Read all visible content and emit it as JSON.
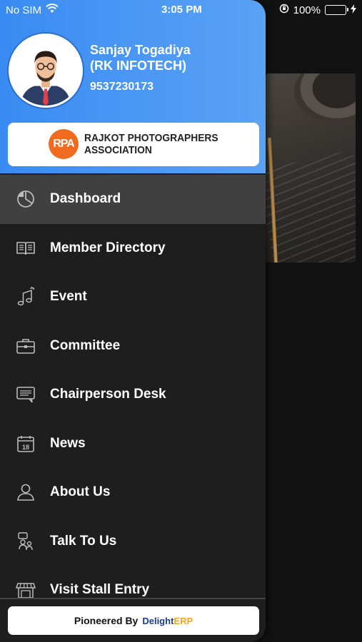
{
  "status_bar": {
    "carrier": "No SIM",
    "time": "3:05 PM",
    "battery": "100%"
  },
  "profile": {
    "name": "Sanjay Togadiya",
    "company": "(RK INFOTECH)",
    "phone": "9537230173"
  },
  "association": {
    "logo_text": "RPA",
    "line1": "RAJKOT PHOTOGRAPHERS",
    "line2": "ASSOCIATION"
  },
  "menu": {
    "items": [
      {
        "label": "Dashboard",
        "icon": "pie-chart-icon",
        "active": true
      },
      {
        "label": "Member Directory",
        "icon": "book-icon"
      },
      {
        "label": "Event",
        "icon": "music-note-icon"
      },
      {
        "label": "Committee",
        "icon": "briefcase-icon"
      },
      {
        "label": "Chairperson Desk",
        "icon": "chat-icon"
      },
      {
        "label": "News",
        "icon": "calendar-icon"
      },
      {
        "label": "About Us",
        "icon": "user-icon"
      },
      {
        "label": "Talk To Us",
        "icon": "support-icon"
      },
      {
        "label": "Visit Stall Entry",
        "icon": "stall-icon"
      }
    ]
  },
  "footer": {
    "text": "Pioneered By",
    "brand_main": "Delight",
    "brand_accent": "ERP"
  },
  "colors": {
    "header_blue": "#3a8bf2",
    "drawer_bg": "#1e1e1f",
    "active_item": "#414040",
    "rpa_orange": "#f06a1f",
    "battery_green": "#4cd964"
  }
}
